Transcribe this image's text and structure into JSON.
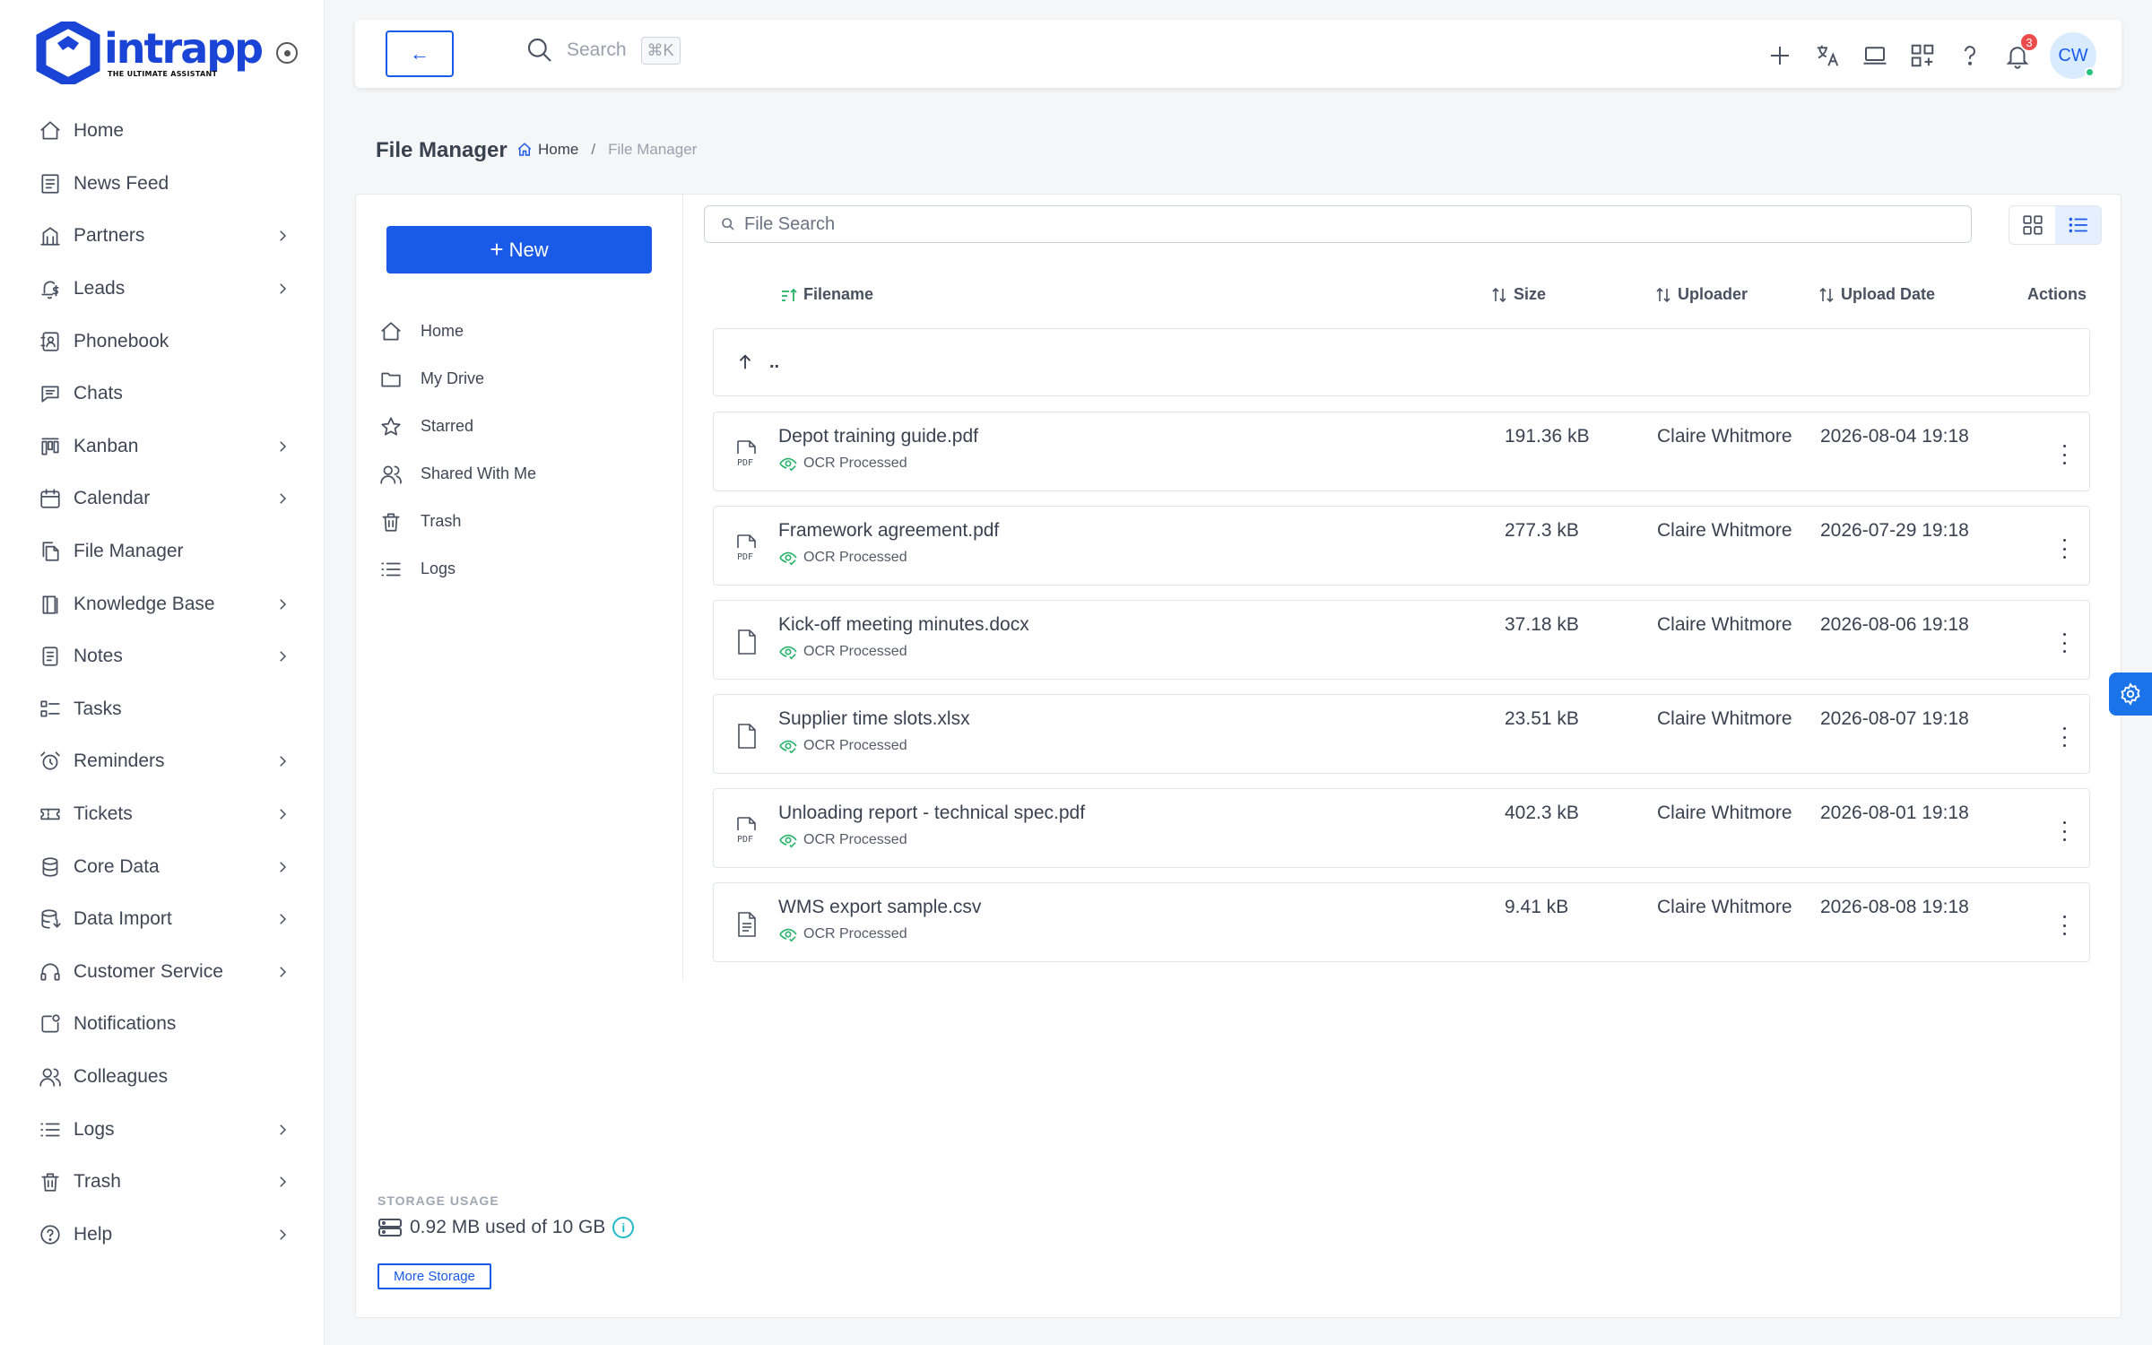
{
  "brand": {
    "name": "intrapp",
    "tagline": "THE ULTIMATE ASSISTANT",
    "color": "#1a44d6"
  },
  "sidebar": {
    "items": [
      {
        "label": "Home",
        "icon": "home-icon",
        "chevron": false
      },
      {
        "label": "News Feed",
        "icon": "newspaper-icon",
        "chevron": false
      },
      {
        "label": "Partners",
        "icon": "building-icon",
        "chevron": true
      },
      {
        "label": "Leads",
        "icon": "bell-dollar-icon",
        "chevron": true
      },
      {
        "label": "Phonebook",
        "icon": "contact-book-icon",
        "chevron": false
      },
      {
        "label": "Chats",
        "icon": "chat-icon",
        "chevron": false
      },
      {
        "label": "Kanban",
        "icon": "kanban-icon",
        "chevron": true
      },
      {
        "label": "Calendar",
        "icon": "calendar-icon",
        "chevron": true
      },
      {
        "label": "File Manager",
        "icon": "files-icon",
        "chevron": false
      },
      {
        "label": "Knowledge Base",
        "icon": "book-icon",
        "chevron": true
      },
      {
        "label": "Notes",
        "icon": "note-icon",
        "chevron": true
      },
      {
        "label": "Tasks",
        "icon": "tasks-icon",
        "chevron": false
      },
      {
        "label": "Reminders",
        "icon": "alarm-icon",
        "chevron": true
      },
      {
        "label": "Tickets",
        "icon": "ticket-icon",
        "chevron": true
      },
      {
        "label": "Core Data",
        "icon": "database-icon",
        "chevron": true
      },
      {
        "label": "Data Import",
        "icon": "database-import-icon",
        "chevron": true
      },
      {
        "label": "Customer Service",
        "icon": "headset-icon",
        "chevron": true
      },
      {
        "label": "Notifications",
        "icon": "notification-icon",
        "chevron": false
      },
      {
        "label": "Colleagues",
        "icon": "users-icon",
        "chevron": false
      },
      {
        "label": "Logs",
        "icon": "list-icon",
        "chevron": true
      },
      {
        "label": "Trash",
        "icon": "trash-icon",
        "chevron": true
      },
      {
        "label": "Help",
        "icon": "help-icon",
        "chevron": true
      }
    ]
  },
  "topbar": {
    "back_label": "←",
    "search_label": "Search",
    "search_shortcut": "⌘K",
    "notification_count": "3",
    "avatar_initials": "CW"
  },
  "page": {
    "title": "File Manager",
    "breadcrumb": {
      "home": "Home",
      "separator": "/",
      "current": "File Manager"
    }
  },
  "file_manager": {
    "new_button": "New",
    "nav": [
      {
        "label": "Home",
        "icon": "home-icon"
      },
      {
        "label": "My Drive",
        "icon": "folder-icon"
      },
      {
        "label": "Starred",
        "icon": "star-icon"
      },
      {
        "label": "Shared With Me",
        "icon": "users-icon"
      },
      {
        "label": "Trash",
        "icon": "trash-icon"
      },
      {
        "label": "Logs",
        "icon": "list-icon"
      }
    ],
    "storage": {
      "title": "STORAGE USAGE",
      "usage_text": "0.92 MB used of 10 GB",
      "info": "i",
      "more_button": "More Storage"
    },
    "search_placeholder": "File Search",
    "columns": {
      "filename": "Filename",
      "size": "Size",
      "uploader": "Uploader",
      "upload_date": "Upload Date",
      "actions": "Actions"
    },
    "parent_dir": "..",
    "files": [
      {
        "name": "Depot training guide.pdf",
        "type": "pdf",
        "status": "OCR Processed",
        "size": "191.36 kB",
        "uploader": "Claire Whitmore",
        "date": "2026-08-04 19:18"
      },
      {
        "name": "Framework agreement.pdf",
        "type": "pdf",
        "status": "OCR Processed",
        "size": "277.3 kB",
        "uploader": "Claire Whitmore",
        "date": "2026-07-29 19:18"
      },
      {
        "name": "Kick-off meeting minutes.docx",
        "type": "doc",
        "status": "OCR Processed",
        "size": "37.18 kB",
        "uploader": "Claire Whitmore",
        "date": "2026-08-06 19:18"
      },
      {
        "name": "Supplier time slots.xlsx",
        "type": "doc",
        "status": "OCR Processed",
        "size": "23.51 kB",
        "uploader": "Claire Whitmore",
        "date": "2026-08-07 19:18"
      },
      {
        "name": "Unloading report - technical spec.pdf",
        "type": "pdf",
        "status": "OCR Processed",
        "size": "402.3 kB",
        "uploader": "Claire Whitmore",
        "date": "2026-08-01 19:18"
      },
      {
        "name": "WMS export sample.csv",
        "type": "text",
        "status": "OCR Processed",
        "size": "9.41 kB",
        "uploader": "Claire Whitmore",
        "date": "2026-08-08 19:18"
      }
    ]
  },
  "colors": {
    "accent": "#1a5ae8",
    "ocr_green": "#27b36a",
    "badge_red": "#ea4c4c",
    "gear_tab": "#1a73e8"
  }
}
